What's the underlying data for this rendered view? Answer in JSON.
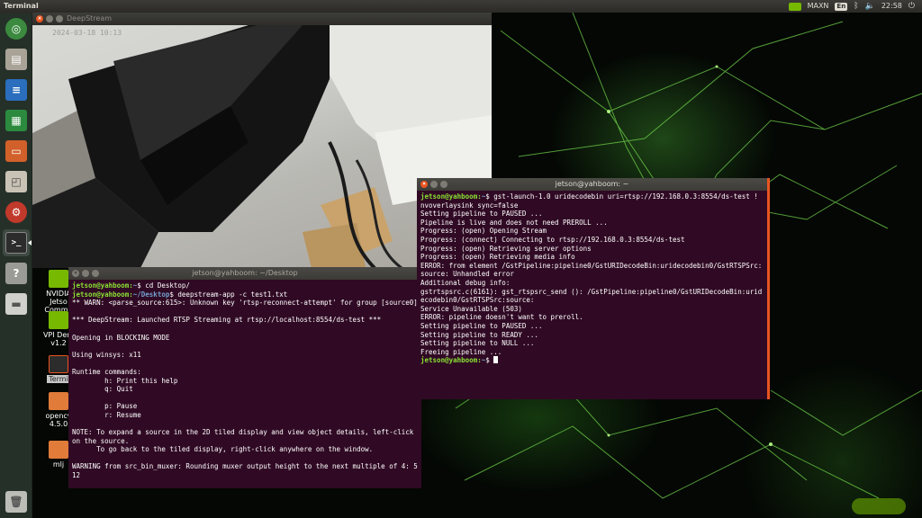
{
  "top_panel": {
    "app_name": "Terminal",
    "power_mode": "MAXN",
    "keyboard_layout": "En",
    "clock": "22:58",
    "icons": [
      "nvidia-icon",
      "keyboard-icon",
      "bluetooth-icon",
      "volume-icon",
      "power-icon"
    ]
  },
  "launcher": {
    "items": [
      "ubuntu-dash",
      "file-manager",
      "writer",
      "calc",
      "impress",
      "software-center",
      "system-settings",
      "terminal",
      "help",
      "drive"
    ],
    "trash": "trash"
  },
  "desktop_icons": [
    {
      "label_lines": [
        "NVIDIA",
        "Jetso",
        "Commu"
      ]
    },
    {
      "label_lines": [
        "VPI Dem",
        "v1.2"
      ]
    },
    {
      "label_lines": [
        "Termi"
      ]
    },
    {
      "label_lines": [
        "opencv",
        "4.5.0"
      ]
    },
    {
      "label_lines": [
        "mlj"
      ]
    }
  ],
  "deepstream": {
    "window_title": "DeepStream",
    "timestamp": "2024-03-18 10:13"
  },
  "terminal_desktop": {
    "title": "jetson@yahboom: ~/Desktop",
    "prompt_user": "jetson@yahboom:",
    "line1_path": "~",
    "line1_cmd": "$ cd Desktop/",
    "line2_path": "~/Desktop",
    "line2_cmd": "$ deepstream-app -c test1.txt",
    "output": "** WARN: <parse_source:615>: Unknown key 'rtsp-reconnect-attempt' for group [source0]\n\n*** DeepStream: Launched RTSP Streaming at rtsp://localhost:8554/ds-test ***\n\nOpening in BLOCKING MODE\n\nUsing winsys: x11\n\nRuntime commands:\n        h: Print this help\n        q: Quit\n\n        p: Pause\n        r: Resume\n\nNOTE: To expand a source in the 2D tiled display and view object details, left-click on the source.\n      To go back to the tiled display, right-click anywhere on the window.\n\nWARNING from src_bin_muxer: Rounding muxer output height to the next multiple of 4: 512"
  },
  "terminal_home": {
    "title": "jetson@yahboom: ~",
    "prompt_user": "jetson@yahboom:",
    "prompt_path": "~",
    "command": "$ gst-launch-1.0 uridecodebin uri=rtsp://192.168.0.3:8554/ds-test ! nvoverlaysink sync=false",
    "output": "Setting pipeline to PAUSED ...\nPipeline is live and does not need PREROLL ...\nProgress: (open) Opening Stream\nProgress: (connect) Connecting to rtsp://192.168.0.3:8554/ds-test\nProgress: (open) Retrieving server options\nProgress: (open) Retrieving media info\nERROR: from element /GstPipeline:pipeline0/GstURIDecodeBin:uridecodebin0/GstRTSPSrc:source: Unhandled error\nAdditional debug info:\ngstrtspsrc.c(6161): gst_rtspsrc_send (): /GstPipeline:pipeline0/GstURIDecodeBin:uridecodebin0/GstRTSPSrc:source:\nService Unavailable (503)\nERROR: pipeline doesn't want to preroll.\nSetting pipeline to PAUSED ...\nSetting pipeline to READY ...\nSetting pipeline to NULL ...\nFreeing pipeline ...",
    "final_prompt_user": "jetson@yahboom:",
    "final_prompt_path": "~",
    "final_prompt_symbol": "$"
  },
  "colors": {
    "terminal_bg": "#300a24",
    "prompt_green": "#8ae234",
    "prompt_blue": "#729fcf",
    "ubuntu_orange": "#e95420",
    "nvidia_green": "#76b900"
  }
}
